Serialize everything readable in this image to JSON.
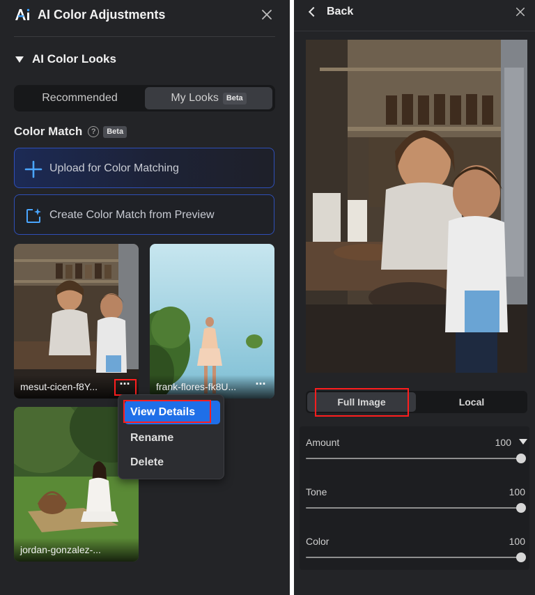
{
  "left_panel": {
    "logo_icon": "ai-logo-icon",
    "title": "AI Color Adjustments",
    "section_title": "AI Color Looks",
    "tabs": {
      "recommended": "Recommended",
      "my_looks": "My Looks",
      "my_looks_badge": "Beta"
    },
    "color_match": {
      "title": "Color Match",
      "help_icon": "?",
      "badge": "Beta"
    },
    "upload_label": "Upload for Color Matching",
    "create_label": "Create Color Match from Preview",
    "thumbnails": [
      {
        "name": "mesut-cicen-f8Y..."
      },
      {
        "name": "frank-flores-fk8U..."
      },
      {
        "name": "jordan-gonzalez-..."
      }
    ],
    "more_icon": "···",
    "context_menu": {
      "view_details": "View Details",
      "rename": "Rename",
      "delete": "Delete"
    }
  },
  "right_panel": {
    "back_label": "Back",
    "tabs": {
      "full_image": "Full Image",
      "local": "Local"
    },
    "sliders": [
      {
        "label": "Amount",
        "value": "100",
        "level": 1.0
      },
      {
        "label": "Tone",
        "value": "100",
        "level": 1.0
      },
      {
        "label": "Color",
        "value": "100",
        "level": 1.0
      }
    ]
  },
  "colors": {
    "panel_bg": "#232427",
    "accent_blue": "#1f6fe8",
    "highlight_red": "#ff1e1e",
    "border_blue": "#2f4fb8"
  }
}
